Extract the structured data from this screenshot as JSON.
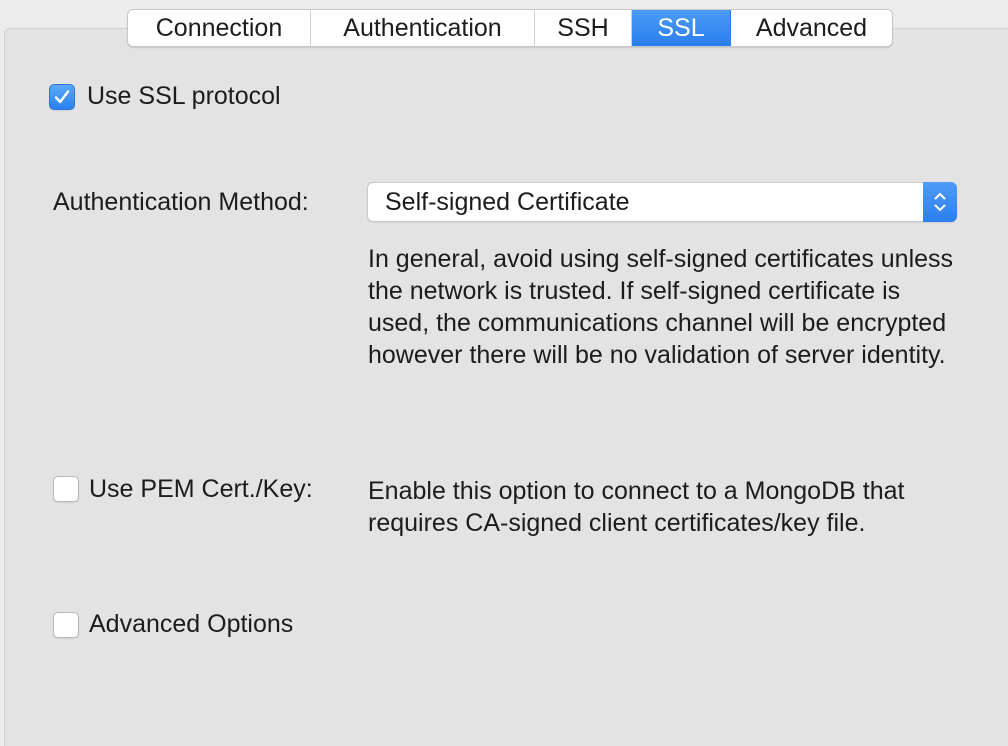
{
  "tabs": [
    {
      "label": "Connection",
      "active": false
    },
    {
      "label": "Authentication",
      "active": false
    },
    {
      "label": "SSH",
      "active": false
    },
    {
      "label": "SSL",
      "active": true
    },
    {
      "label": "Advanced",
      "active": false
    }
  ],
  "ssl": {
    "use_ssl_label": "Use SSL protocol",
    "use_ssl_checked": true,
    "auth_method_label": "Authentication Method:",
    "auth_method_value": "Self-signed Certificate",
    "auth_method_help": "In general, avoid using self-signed certificates unless the network is trusted. If self-signed certificate is used, the communications channel will be encrypted however there will be no validation of server identity.",
    "pem_label": "Use PEM Cert./Key:",
    "pem_checked": false,
    "pem_help": "Enable this option to connect to a MongoDB that requires CA-signed client certificates/key file.",
    "advanced_label": "Advanced Options",
    "advanced_checked": false
  },
  "icons": {
    "check": "checkmark-icon",
    "stepper": "up-down-chevron-icon"
  },
  "colors": {
    "accent": "#2a7ff0",
    "panel": "#e3e3e3"
  }
}
